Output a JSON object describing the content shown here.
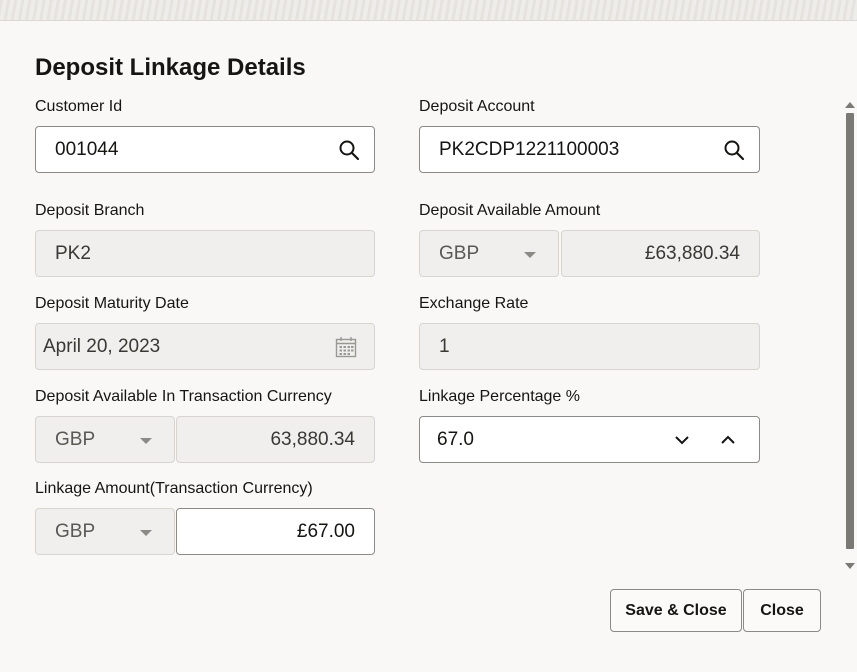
{
  "dialog": {
    "title": "Deposit Linkage Details"
  },
  "fields": {
    "customer_id": {
      "label": "Customer Id",
      "value": "001044"
    },
    "deposit_account": {
      "label": "Deposit Account",
      "value": "PK2CDP1221100003"
    },
    "deposit_branch": {
      "label": "Deposit Branch",
      "value": "PK2"
    },
    "deposit_available_amount": {
      "label": "Deposit Available Amount",
      "currency": "GBP",
      "value": "£63,880.34"
    },
    "deposit_maturity_date": {
      "label": "Deposit Maturity Date",
      "value": "April 20, 2023"
    },
    "exchange_rate": {
      "label": "Exchange Rate",
      "value": "1"
    },
    "deposit_available_txn_ccy": {
      "label": "Deposit Available In Transaction Currency",
      "currency": "GBP",
      "value": "63,880.34"
    },
    "linkage_percentage": {
      "label": "Linkage Percentage %",
      "value": "67.0"
    },
    "linkage_amount": {
      "label": "Linkage Amount(Transaction Currency)",
      "currency": "GBP",
      "value": "£67.00"
    }
  },
  "buttons": {
    "save_close": "Save & Close",
    "close": "Close"
  },
  "icons": {
    "search": "search-icon",
    "calendar": "calendar-icon",
    "chevron_down": "chevron-down-icon",
    "chevron_up": "chevron-up-icon"
  }
}
